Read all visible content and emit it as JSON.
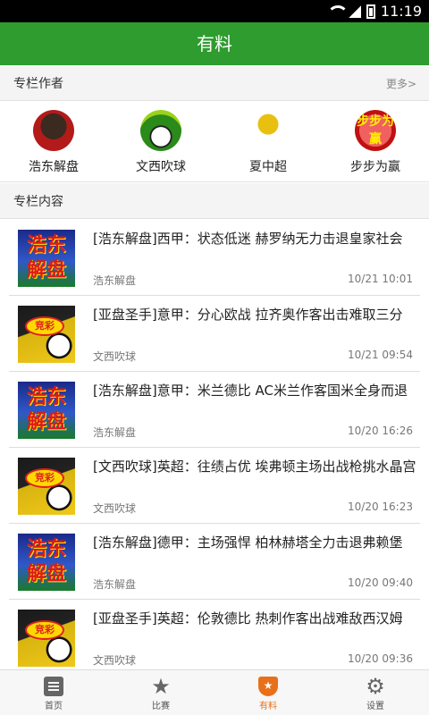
{
  "status": {
    "time": "11:19"
  },
  "header": {
    "title": "有料"
  },
  "authors_section": {
    "label": "专栏作者",
    "more": "更多>"
  },
  "authors": [
    {
      "name": "浩东解盘"
    },
    {
      "name": "文西吹球"
    },
    {
      "name": "夏中超"
    },
    {
      "name": "步步为赢",
      "avatar_text": "步步为赢"
    }
  ],
  "content_section": {
    "label": "专栏内容"
  },
  "articles": [
    {
      "title": "[浩东解盘]西甲：状态低迷 赫罗纳无力击退皇家社会",
      "author": "浩东解盘",
      "time": "10/21 10:01",
      "thumb": "浩东解盘"
    },
    {
      "title": "[亚盘圣手]意甲：分心欧战 拉齐奥作客出击难取三分",
      "author": "文西吹球",
      "time": "10/21 09:54",
      "thumb": "竞彩"
    },
    {
      "title": "[浩东解盘]意甲：米兰德比 AC米兰作客国米全身而退",
      "author": "浩东解盘",
      "time": "10/20 16:26",
      "thumb": "浩东解盘"
    },
    {
      "title": "[文西吹球]英超：往绩占优 埃弗顿主场出战枪挑水晶宫",
      "author": "文西吹球",
      "time": "10/20 16:23",
      "thumb": "竞彩"
    },
    {
      "title": "[浩东解盘]德甲：主场强悍 柏林赫塔全力击退弗赖堡",
      "author": "浩东解盘",
      "time": "10/20 09:40",
      "thumb": "浩东解盘"
    },
    {
      "title": "[亚盘圣手]英超：伦敦德比 热刺作客出战难敌西汉姆",
      "author": "文西吹球",
      "time": "10/20 09:36",
      "thumb": "竞彩"
    }
  ],
  "tabs": [
    {
      "label": "首页",
      "icon": "home-icon"
    },
    {
      "label": "比赛",
      "icon": "star-icon"
    },
    {
      "label": "有料",
      "icon": "badge-icon",
      "active": true
    },
    {
      "label": "设置",
      "icon": "gear-icon"
    }
  ],
  "colors": {
    "primary_green": "#2e9c2e",
    "active_orange": "#e8701a"
  }
}
